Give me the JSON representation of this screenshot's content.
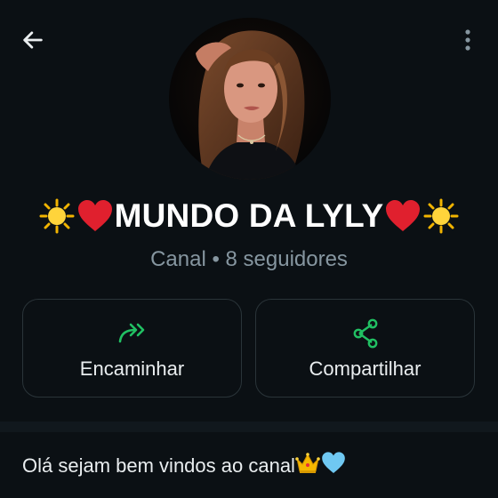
{
  "header": {
    "back_icon": "arrow-left-icon",
    "menu_icon": "more-vertical-icon"
  },
  "channel": {
    "name": "MUNDO DA LYLY",
    "name_prefix_emojis": [
      "sun-icon",
      "red-heart-icon"
    ],
    "name_suffix_emojis": [
      "red-heart-icon",
      "sun-icon"
    ],
    "subtitle": "Canal • 8 seguidores"
  },
  "actions": [
    {
      "label": "Encaminhar",
      "icon": "forward-arrows-icon"
    },
    {
      "label": "Compartilhar",
      "icon": "share-icon"
    }
  ],
  "description": {
    "text": "Olá sejam bem vindos ao canal",
    "emojis": [
      "crown-icon",
      "light-blue-heart-icon"
    ]
  },
  "colors": {
    "background": "#0b1014",
    "accent_green": "#21c063",
    "card_border": "#2a3439",
    "muted_text": "#8696a0"
  }
}
